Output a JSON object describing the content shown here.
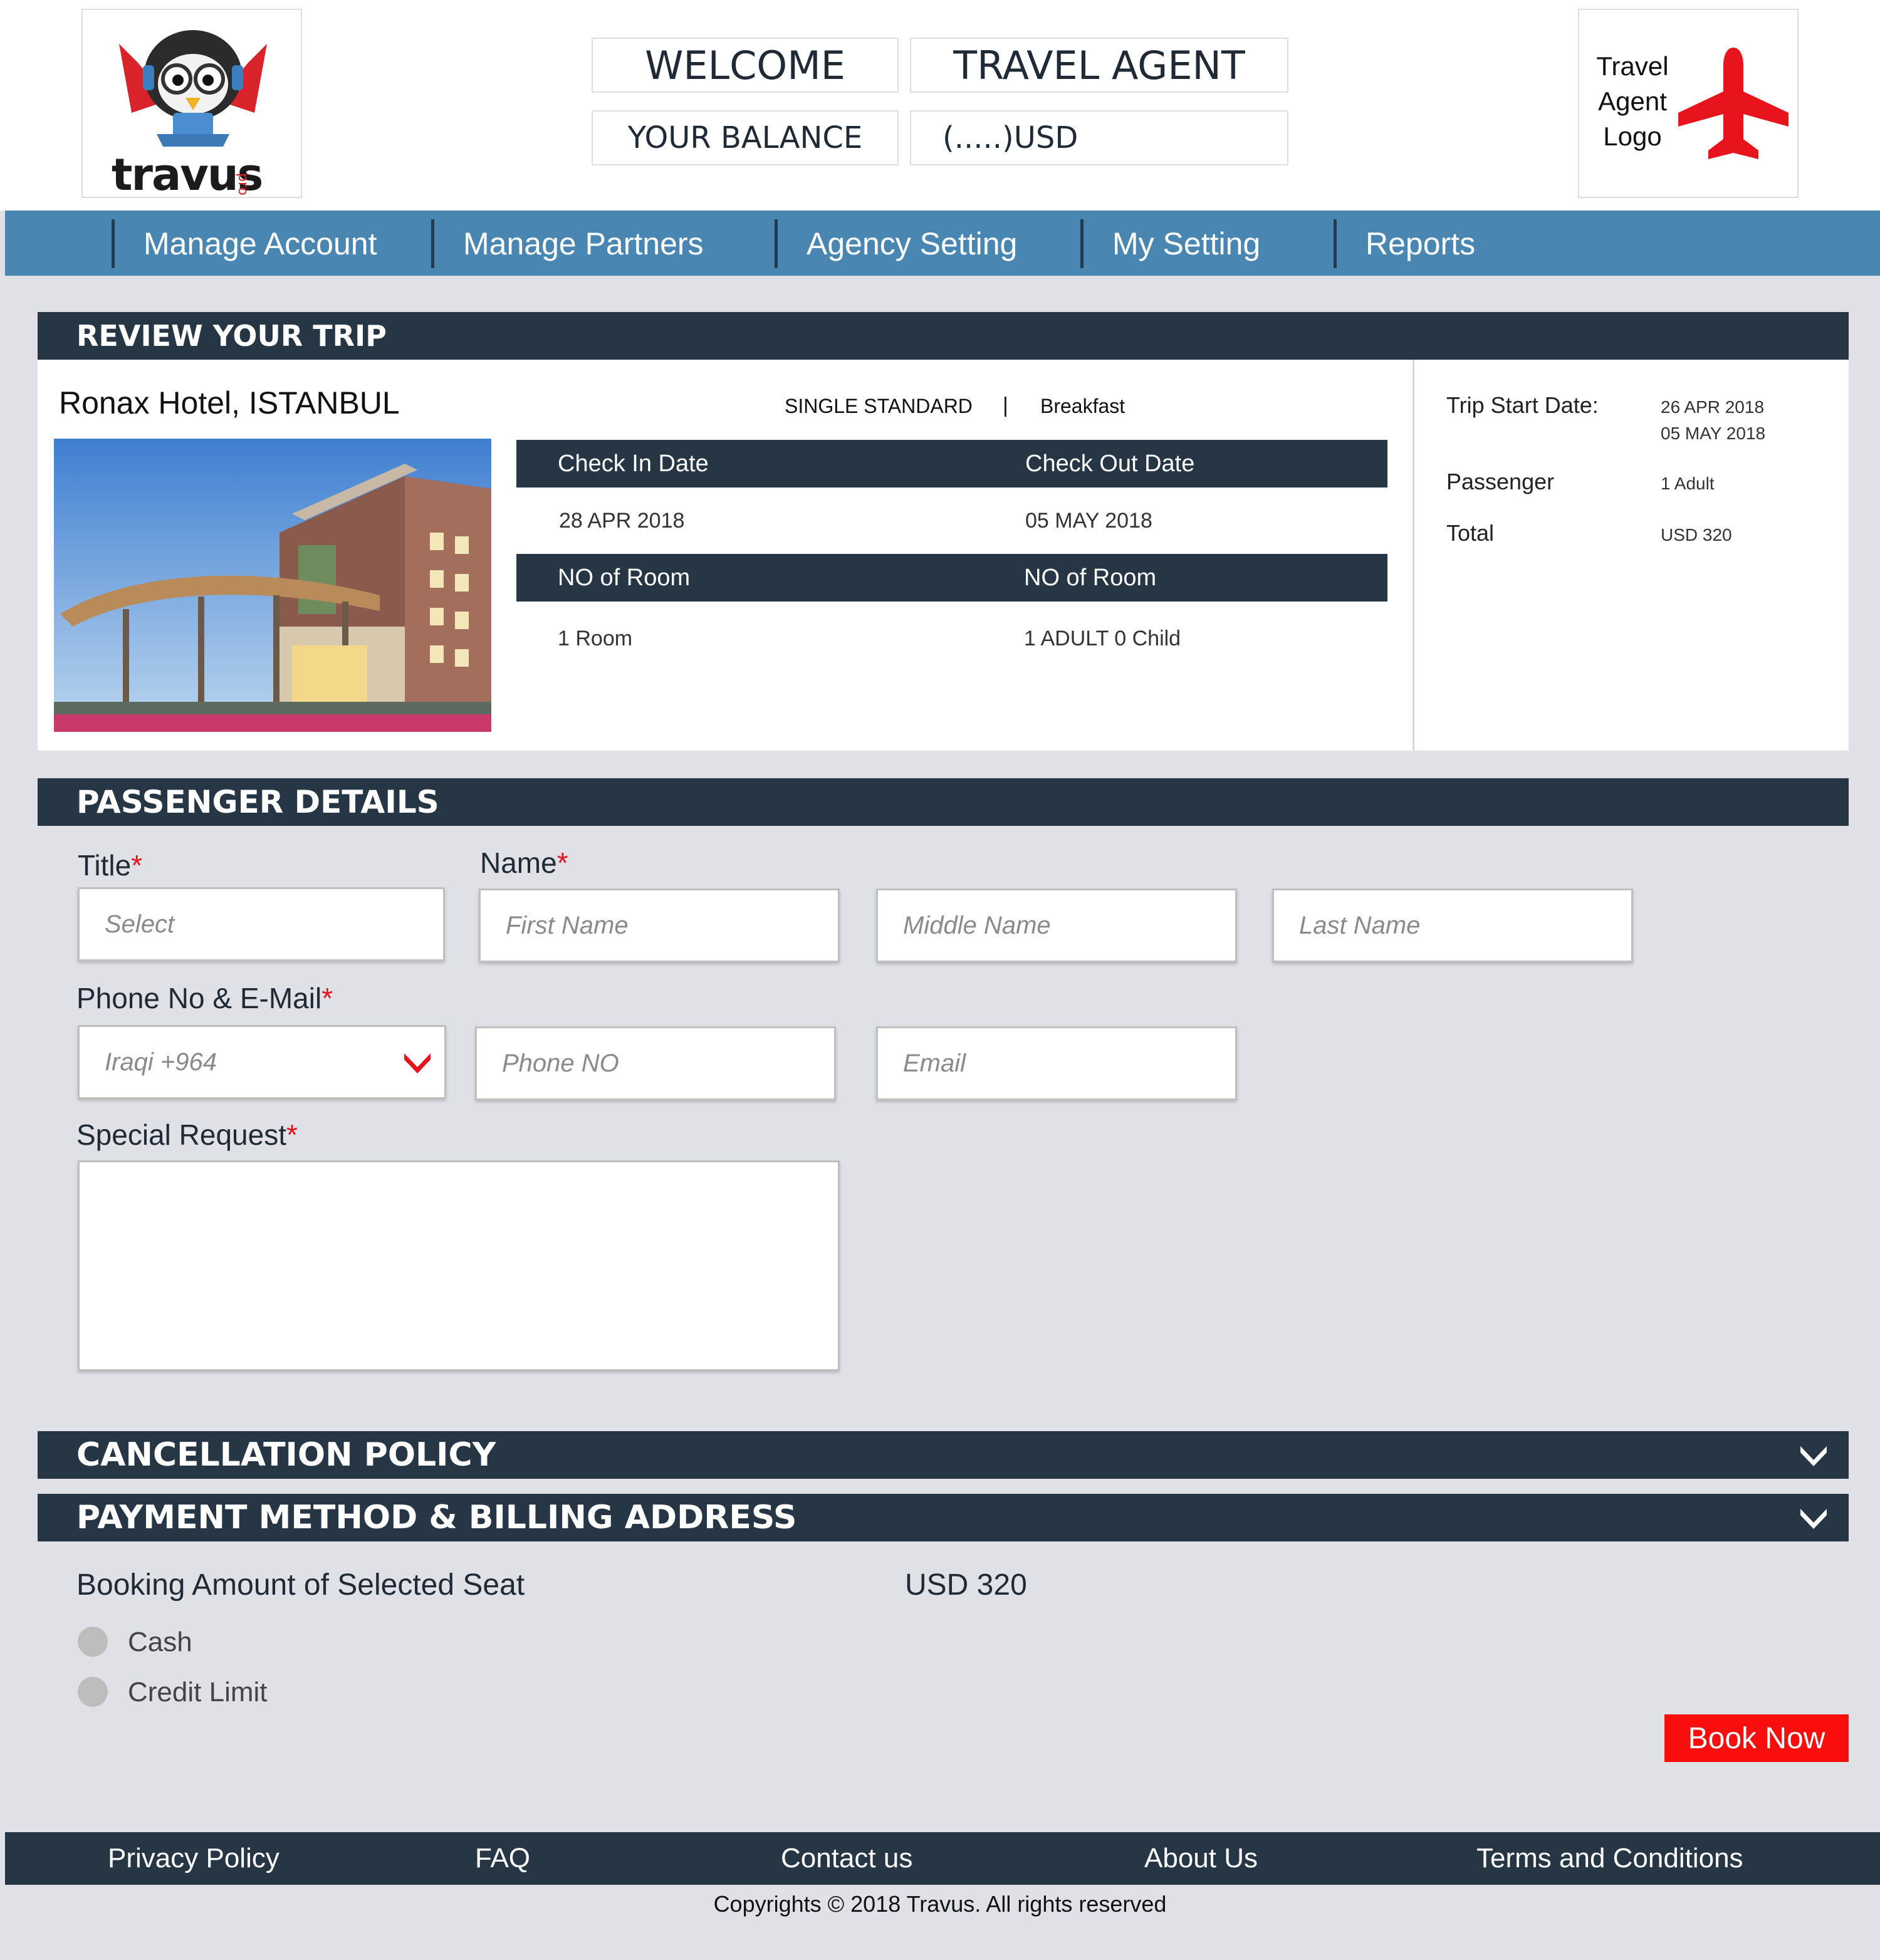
{
  "header": {
    "brand_name": "travus",
    "brand_badge": "pro",
    "welcome_label": "WELCOME",
    "agent_name": "TRAVEL AGENT",
    "balance_label": "YOUR BALANCE",
    "balance_value": "(.....)USD",
    "agent_logo_text": "Travel Agent Logo"
  },
  "nav": {
    "items": [
      "Manage Account",
      "Manage Partners",
      "Agency Setting",
      "My Setting",
      "Reports"
    ]
  },
  "review": {
    "section_title": "REVIEW YOUR TRIP",
    "hotel_name": "Ronax Hotel, ISTANBUL",
    "room_type": "SINGLE STANDARD",
    "separator": "|",
    "meal_plan": "Breakfast",
    "check_in_label": "Check In Date",
    "check_out_label": "Check Out Date",
    "check_in_value": "28 APR 2018",
    "check_out_value": "05 MAY 2018",
    "rooms_label": "NO of Room",
    "guests_label": "NO of Room",
    "rooms_value": "1 Room",
    "guests_value": "1 ADULT 0 Child",
    "summary": {
      "trip_start_label": "Trip Start Date:",
      "trip_start_value": "26 APR 2018",
      "trip_end_value": "05 MAY 2018",
      "passenger_label": "Passenger",
      "passenger_value": "1 Adult",
      "total_label": "Total",
      "total_value": "USD 320"
    }
  },
  "passenger": {
    "section_title": "PASSENGER DETAILS",
    "title_label": "Title",
    "name_label": "Name",
    "required_mark": "*",
    "title_placeholder": "Select",
    "first_name_placeholder": "First Name",
    "middle_name_placeholder": "Middle Name",
    "last_name_placeholder": "Last Name",
    "contact_label": "Phone No & E-Mail",
    "country_code_value": "Iraqi +964",
    "phone_placeholder": "Phone NO",
    "email_placeholder": "Email",
    "special_request_label": "Special Request"
  },
  "cancellation": {
    "section_title": "CANCELLATION POLICY"
  },
  "payment": {
    "section_title": "PAYMENT METHOD & BILLING ADDRESS",
    "amount_label": "Booking Amount of Selected Seat",
    "amount_value": "USD 320",
    "options": [
      "Cash",
      "Credit Limit"
    ],
    "book_button": "Book Now"
  },
  "footer": {
    "links": [
      "Privacy Policy",
      "FAQ",
      "Contact us",
      "About Us",
      "Terms and Conditions"
    ],
    "copyright": "Copyrights © 2018 Travus. All rights reserved"
  },
  "colors": {
    "nav_blue": "#4a86b2",
    "dark_navy": "#263645",
    "accent_red": "#e8141d",
    "page_bg": "#e0e1e6"
  },
  "icons": [
    "travus-mascot-icon",
    "airplane-icon",
    "chevron-down-icon"
  ]
}
